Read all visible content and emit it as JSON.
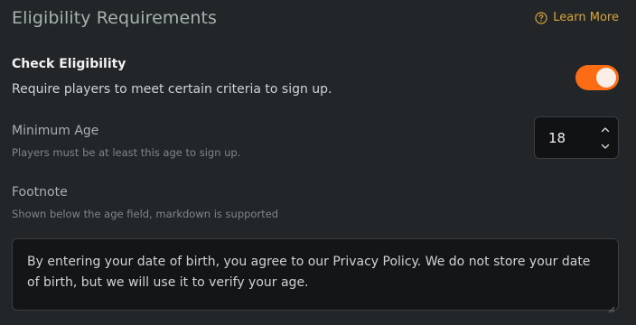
{
  "header": {
    "title": "Eligibility Requirements",
    "learn_more": "Learn More",
    "learn_more_icon": "help-circle-icon",
    "accent_color": "#d9a53a"
  },
  "eligibility": {
    "label": "Check Eligibility",
    "description": "Require players to meet certain criteria to sign up.",
    "enabled": true,
    "toggle_color": "#fb6c15"
  },
  "min_age": {
    "label": "Minimum Age",
    "help": "Players must be at least this age to sign up.",
    "value": "18",
    "icons": [
      "chevron-up-icon",
      "chevron-down-icon"
    ]
  },
  "footnote": {
    "label": "Footnote",
    "help": "Shown below the age field, markdown is supported",
    "value": "By entering your date of birth, you agree to our Privacy Policy. We do not store your date of birth, but we will use it to verify your age."
  }
}
